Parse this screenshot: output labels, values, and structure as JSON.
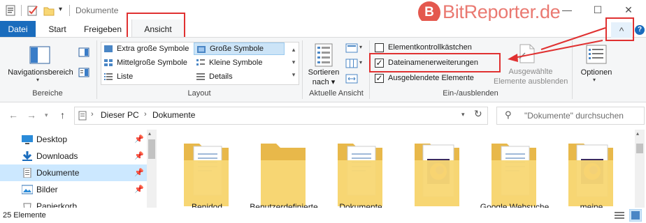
{
  "window": {
    "title": "Dokumente",
    "minimize": "—",
    "maximize": "☐",
    "close": "✕"
  },
  "watermark": {
    "logo": "B",
    "text": "BitReporter.de"
  },
  "tabs": [
    {
      "label": "Datei",
      "active": false
    },
    {
      "label": "Start",
      "active": false
    },
    {
      "label": "Freigeben",
      "active": false
    },
    {
      "label": "Ansicht",
      "active": true
    }
  ],
  "ribbon": {
    "collapse_glyph": "^",
    "help_glyph": "?",
    "bereiche": {
      "group_label": "Bereiche",
      "navigationsbereich": "Navigationsbereich"
    },
    "layout": {
      "group_label": "Layout",
      "items": [
        "Extra große Symbole",
        "Große Symbole",
        "Mittelgroße Symbole",
        "Kleine Symbole",
        "Liste",
        "Details"
      ],
      "selected": "Große Symbole"
    },
    "aktuelle_ansicht": {
      "group_label": "Aktuelle Ansicht",
      "sortieren_line1": "Sortieren",
      "sortieren_line2": "nach"
    },
    "ein_ausblenden": {
      "group_label": "Ein-/ausblenden",
      "checkboxes": [
        {
          "label": "Elementkontrollkästchen",
          "checked": false
        },
        {
          "label": "Dateinamenerweiterungen",
          "checked": true
        },
        {
          "label": "Ausgeblendete Elemente",
          "checked": true
        }
      ],
      "ausgewaehlte_line1": "Ausgewählte",
      "ausgewaehlte_line2": "Elemente ausblenden"
    },
    "optionen": {
      "label": "Optionen"
    }
  },
  "address": {
    "path": [
      "Dieser PC",
      "Dokumente"
    ],
    "search_placeholder": "\"Dokumente\" durchsuchen"
  },
  "nav_pane": {
    "items": [
      {
        "label": "Desktop",
        "icon": "desktop-icon",
        "pinned": true,
        "selected": false
      },
      {
        "label": "Downloads",
        "icon": "download-arrow-icon",
        "pinned": true,
        "selected": false
      },
      {
        "label": "Dokumente",
        "icon": "document-icon",
        "pinned": true,
        "selected": true
      },
      {
        "label": "Bilder",
        "icon": "picture-icon",
        "pinned": true,
        "selected": false
      },
      {
        "label": "Papierkorb",
        "icon": "recycle-bin-icon",
        "pinned": false,
        "selected": false
      }
    ]
  },
  "folders": [
    {
      "icon": "folder-with-documents-icon",
      "caption": "Benjdod"
    },
    {
      "icon": "empty-folder-icon",
      "caption": "Benutzerdefinierte"
    },
    {
      "icon": "folder-with-documents-icon",
      "caption": "Dokumente"
    },
    {
      "icon": "folder-with-firefox-icon",
      "caption": ""
    },
    {
      "icon": "folder-with-documents-icon",
      "caption": "Google Websuche"
    },
    {
      "icon": "folder-with-firefox-icon",
      "caption": "meine"
    }
  ],
  "status": {
    "count": "25 Elemente"
  }
}
